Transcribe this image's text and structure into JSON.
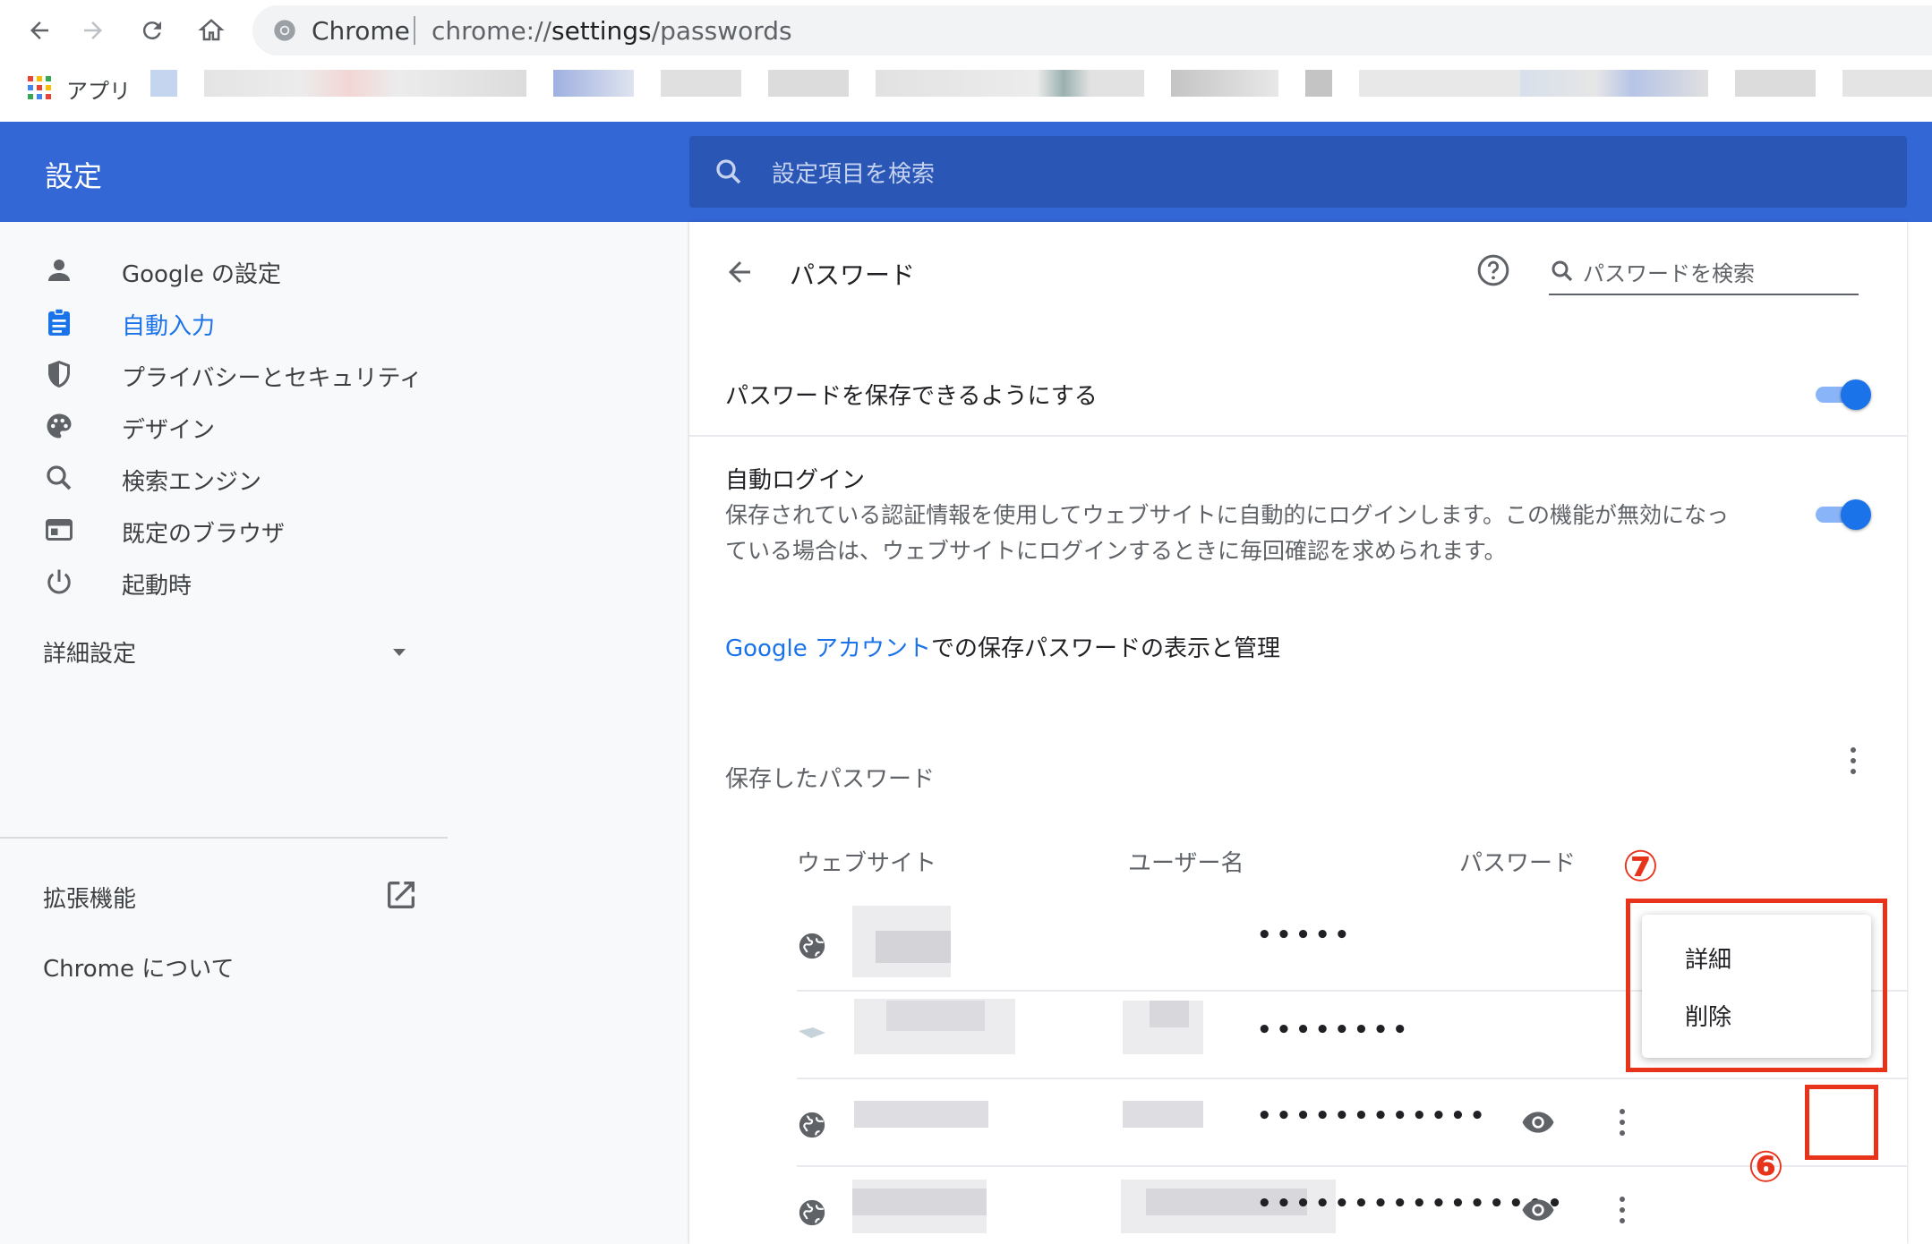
{
  "browser": {
    "omnibox_prefix": "Chrome",
    "url_scheme": "chrome://",
    "url_host": "settings",
    "url_path": "/passwords",
    "bookmarks_apps_label": "アプリ"
  },
  "header": {
    "title": "設定",
    "search_placeholder": "設定項目を検索"
  },
  "sidebar": {
    "items": [
      {
        "label": "Google の設定",
        "icon": "person-icon"
      },
      {
        "label": "自動入力",
        "icon": "assignment-icon"
      },
      {
        "label": "プライバシーとセキュリティ",
        "icon": "shield-icon"
      },
      {
        "label": "デザイン",
        "icon": "palette-icon"
      },
      {
        "label": "検索エンジン",
        "icon": "search-icon"
      },
      {
        "label": "既定のブラウザ",
        "icon": "browser-icon"
      },
      {
        "label": "起動時",
        "icon": "power-icon"
      }
    ],
    "advanced_label": "詳細設定",
    "extensions_label": "拡張機能",
    "about_label": "Chrome について"
  },
  "passwords": {
    "title": "パスワード",
    "search_placeholder": "パスワードを検索",
    "offer_save_label": "パスワードを保存できるようにする",
    "offer_save_enabled": true,
    "autosignin_title": "自動ログイン",
    "autosignin_desc_line1": "保存されている認証情報を使用してウェブサイトに自動的にログインします。この機能が無効になっ",
    "autosignin_desc_line2": "ている場合は、ウェブサイトにログインするときに毎回確認を求められます。",
    "autosignin_enabled": true,
    "account_link": "Google アカウント",
    "account_text": "での保存パスワードの表示と管理",
    "saved_title": "保存したパスワード",
    "columns": {
      "site": "ウェブサイト",
      "user": "ユーザー名",
      "password": "パスワード"
    },
    "rows": [
      {
        "password_mask": "•••••"
      },
      {
        "password_mask": "••••••••"
      },
      {
        "password_mask": "••••••••••••"
      },
      {
        "password_mask": "••••••••••••••••"
      }
    ],
    "menu": {
      "details": "詳細",
      "remove": "削除"
    }
  },
  "annotations": {
    "menu_marker": "⑦",
    "button_marker": "⑥"
  },
  "colors": {
    "header_blue": "#3367d6",
    "accent": "#1a73e8",
    "annotation_red": "#e8331b"
  }
}
